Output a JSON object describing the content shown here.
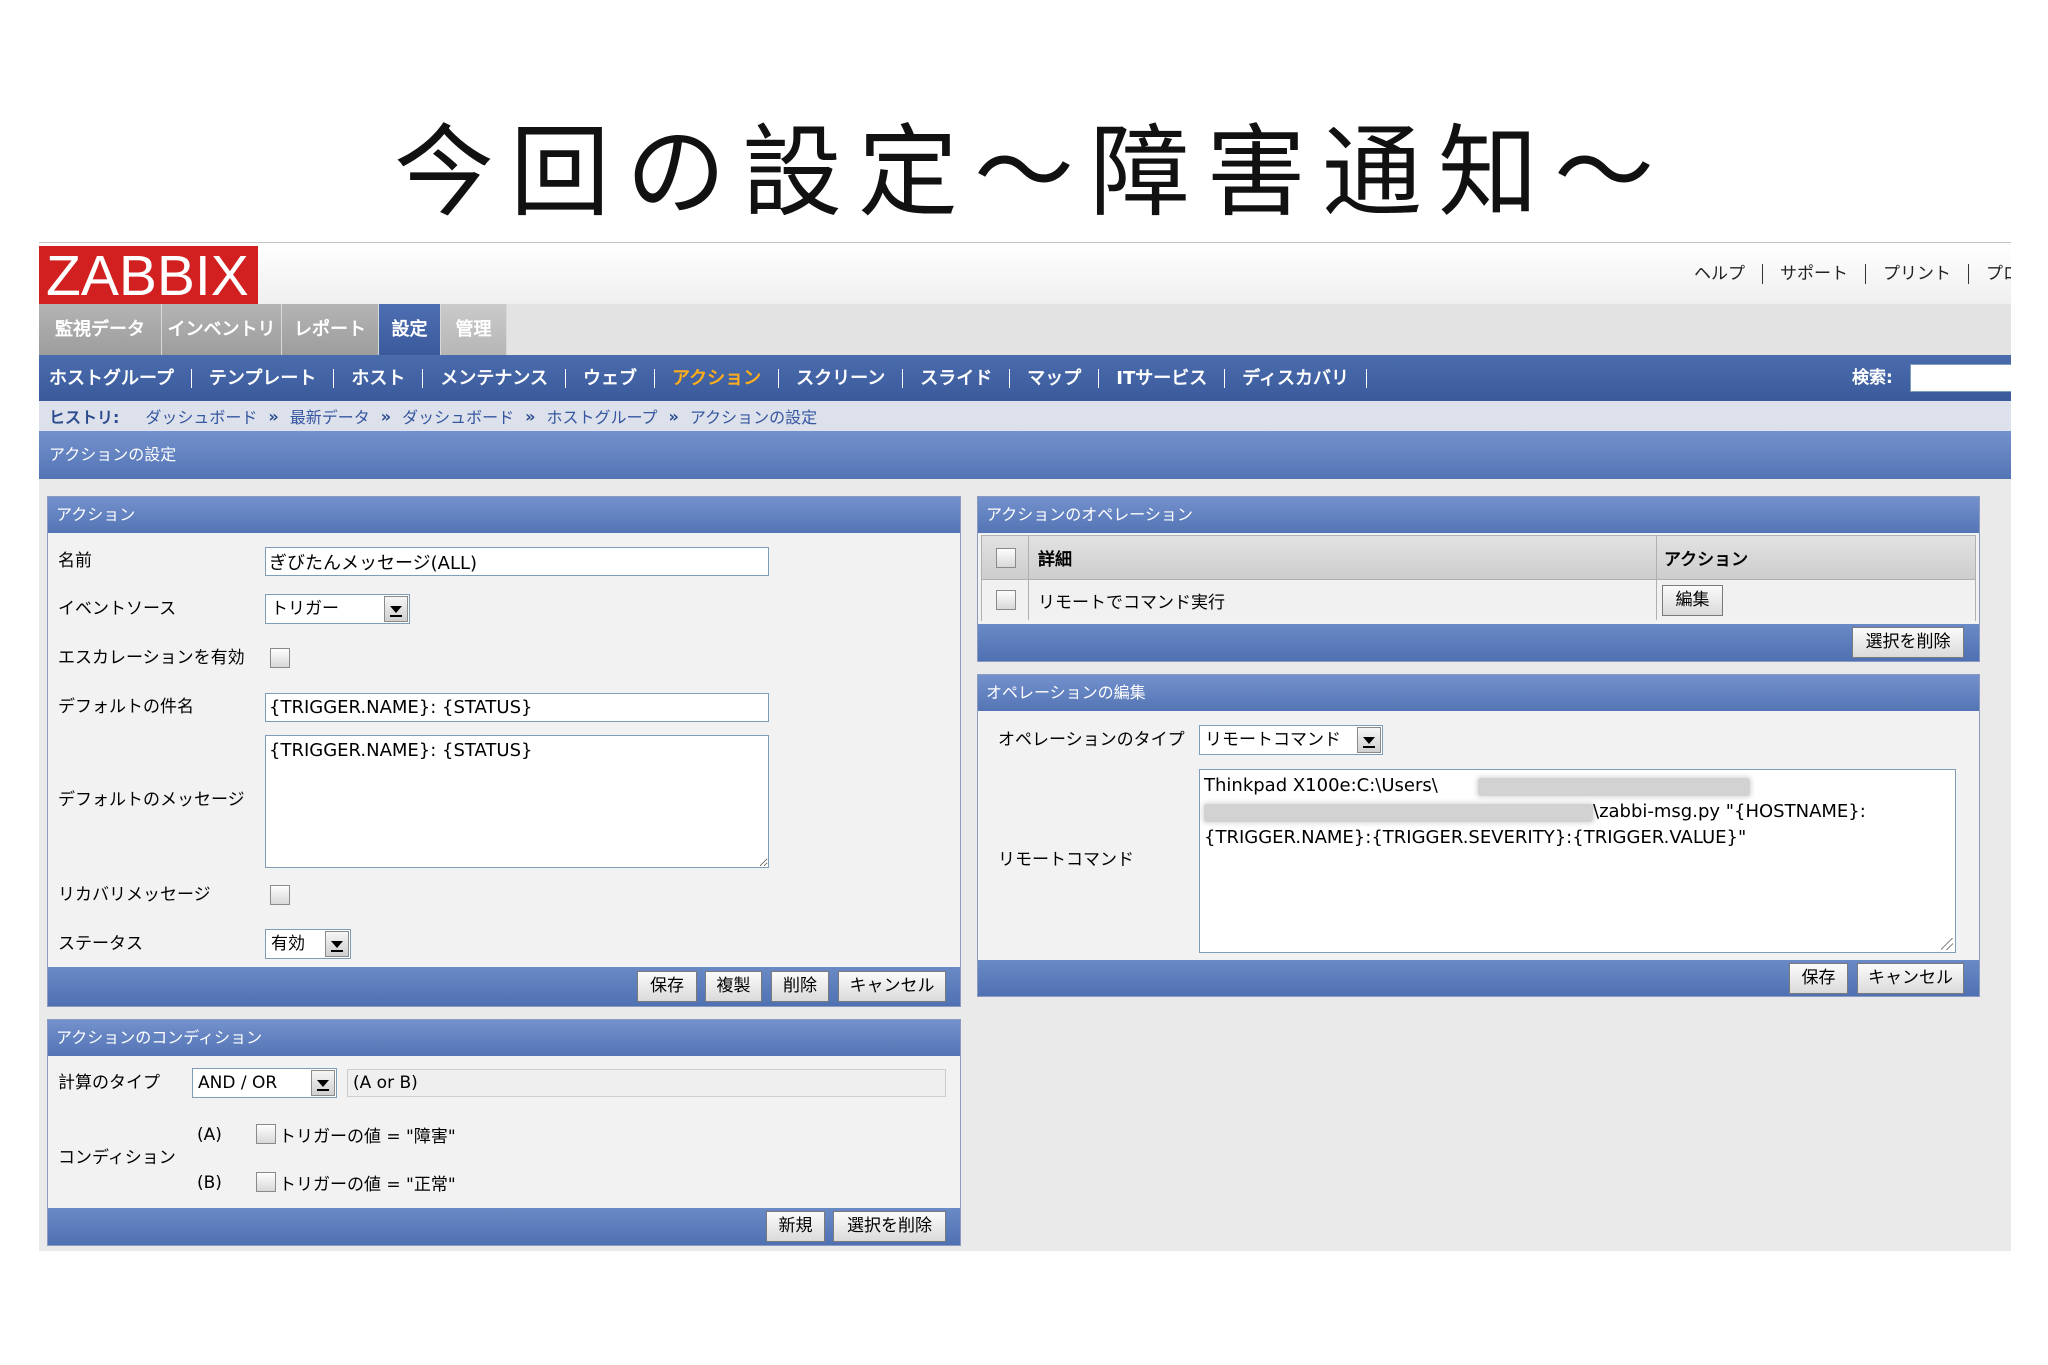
{
  "slide": {
    "title": "今回の設定〜障害通知〜"
  },
  "header": {
    "logo": "ZABBIX",
    "links": [
      "ヘルプ",
      "サポート",
      "プリント",
      "プロ"
    ]
  },
  "main_tabs": [
    {
      "label": "監視データ",
      "active": false
    },
    {
      "label": "インベントリ",
      "active": false
    },
    {
      "label": "レポート",
      "active": false
    },
    {
      "label": "設定",
      "active": true
    },
    {
      "label": "管理",
      "active": false
    }
  ],
  "sub_menu": {
    "items": [
      {
        "label": "ホストグループ",
        "active": false
      },
      {
        "label": "テンプレート",
        "active": false
      },
      {
        "label": "ホスト",
        "active": false
      },
      {
        "label": "メンテナンス",
        "active": false
      },
      {
        "label": "ウェブ",
        "active": false
      },
      {
        "label": "アクション",
        "active": true
      },
      {
        "label": "スクリーン",
        "active": false
      },
      {
        "label": "スライド",
        "active": false
      },
      {
        "label": "マップ",
        "active": false
      },
      {
        "label": "ITサービス",
        "active": false
      },
      {
        "label": "ディスカバリ",
        "active": false
      }
    ],
    "search_label": "検索:"
  },
  "history": {
    "label": "ヒストリ:",
    "separator": "»",
    "items": [
      "ダッシュボード",
      "最新データ",
      "ダッシュボード",
      "ホストグループ",
      "アクションの設定"
    ]
  },
  "page_title": "アクションの設定",
  "action_form": {
    "title": "アクション",
    "name_label": "名前",
    "name_value": "ぎびたんメッセージ(ALL)",
    "event_source_label": "イベントソース",
    "event_source_value": "トリガー",
    "escalation_label": "エスカレーションを有効",
    "escalation_checked": false,
    "default_subject_label": "デフォルトの件名",
    "default_subject_value": "{TRIGGER.NAME}: {STATUS}",
    "default_message_label": "デフォルトのメッセージ",
    "default_message_value": "{TRIGGER.NAME}: {STATUS}",
    "recovery_label": "リカバリメッセージ",
    "recovery_checked": false,
    "status_label": "ステータス",
    "status_value": "有効",
    "buttons": {
      "save": "保存",
      "clone": "複製",
      "delete": "削除",
      "cancel": "キャンセル"
    }
  },
  "conditions": {
    "title": "アクションのコンディション",
    "calc_type_label": "計算のタイプ",
    "calc_type_value": "AND / OR",
    "formula": "(A or B)",
    "condition_label": "コンディション",
    "items": [
      {
        "key": "(A)",
        "text": "トリガーの値 = \"障害\"",
        "checked": false
      },
      {
        "key": "(B)",
        "text": "トリガーの値 = \"正常\"",
        "checked": false
      }
    ],
    "buttons": {
      "new": "新規",
      "delete_selected": "選択を削除"
    }
  },
  "operations": {
    "title": "アクションのオペレーション",
    "columns": [
      "詳細",
      "アクション"
    ],
    "rows": [
      {
        "detail": "リモートでコマンド実行",
        "action": "編集",
        "checked": false
      }
    ],
    "delete_selected": "選択を削除"
  },
  "operation_edit": {
    "title": "オペレーションの編集",
    "type_label": "オペレーションのタイプ",
    "type_value": "リモートコマンド",
    "command_label": "リモートコマンド",
    "command_line1": "Thinkpad X100e:C:\\Users\\",
    "command_line2": "\\zabbi-msg.py \"{HOSTNAME}:",
    "command_line3": "{TRIGGER.NAME}:{TRIGGER.SEVERITY}:{TRIGGER.VALUE}\"",
    "buttons": {
      "save": "保存",
      "cancel": "キャンセル"
    }
  },
  "colors": {
    "logo": "#d21f1f",
    "nav": "#3a5a9c",
    "accent": "#ffad1a",
    "header": "#5474b5"
  }
}
